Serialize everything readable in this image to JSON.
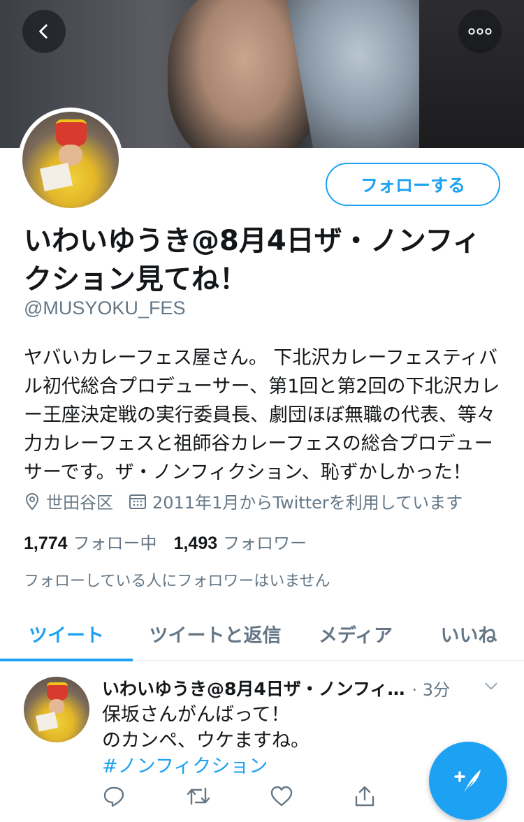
{
  "profile": {
    "follow_label": "フォローする",
    "name": "いわいゆうき@8月4日ザ・ノンフィクション見てね！",
    "handle": "@MUSYOKU_FES",
    "bio": "ヤバいカレーフェス屋さん。 下北沢カレーフェスティバル初代総合プロデューサー、第1回と第2回の下北沢カレー王座決定戦の実行委員長、劇団ほぼ無職の代表、等々力カレーフェスと祖師谷カレーフェスの総合プロデューサーです。ザ・ノンフィクション、恥ずかしかった！",
    "location": "世田谷区",
    "joined": "2011年1月からTwitterを利用しています",
    "following_count": "1,774",
    "following_label": "フォロー中",
    "followers_count": "1,493",
    "followers_label": "フォロワー",
    "no_known_followers": "フォローしている人にフォロワーはいません"
  },
  "tabs": [
    {
      "label": "ツイート",
      "active": true
    },
    {
      "label": "ツイートと返信",
      "active": false
    },
    {
      "label": "メディア",
      "active": false
    },
    {
      "label": "いいね",
      "active": false
    }
  ],
  "tweet": {
    "author": "いわいゆうき@8月4日ザ・ノンフィ…",
    "time": "· 3分",
    "line1": "保坂さんがんばって！",
    "line2": "のカンペ、ウケますね。",
    "hashtag": "#ノンフィクション"
  },
  "icons": {
    "back": "chevron-left-icon",
    "more": "more-dots-icon",
    "location": "location-pin-icon",
    "calendar": "calendar-icon",
    "reply": "reply-icon",
    "retweet": "retweet-icon",
    "like": "heart-icon",
    "share": "share-icon",
    "compose": "compose-tweet-icon"
  },
  "colors": {
    "accent": "#1da1f2",
    "text": "#14171a",
    "secondary": "#657786"
  }
}
